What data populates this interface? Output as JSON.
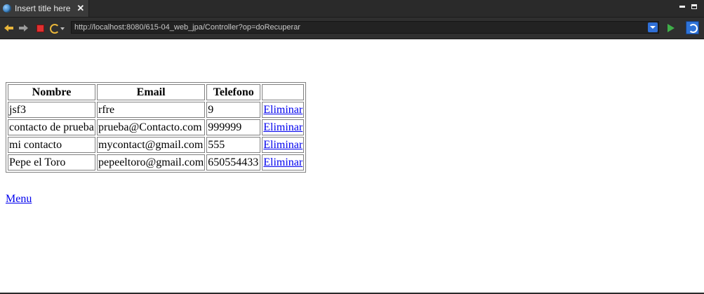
{
  "tab": {
    "title": "Insert title here",
    "close": "✕"
  },
  "toolbar": {
    "url": "http://localhost:8080/615-04_web_jpa/Controller?op=doRecuperar"
  },
  "table": {
    "headers": [
      "Nombre",
      "Email",
      "Telefono",
      ""
    ],
    "rows": [
      {
        "nombre": "jsf3",
        "email": "rfre",
        "telefono": "9",
        "accion": "Eliminar"
      },
      {
        "nombre": "contacto de prueba",
        "email": "prueba@Contacto.com",
        "telefono": "999999",
        "accion": "Eliminar"
      },
      {
        "nombre": "mi contacto",
        "email": "mycontact@gmail.com",
        "telefono": "555",
        "accion": "Eliminar"
      },
      {
        "nombre": "Pepe el Toro",
        "email": "pepeeltoro@gmail.com",
        "telefono": "650554433",
        "accion": "Eliminar"
      }
    ]
  },
  "menu_link": "Menu",
  "icons": {
    "tab": "globe-icon",
    "back": "back-arrow-icon",
    "forward": "forward-arrow-icon",
    "stop": "stop-icon",
    "refresh": "refresh-icon",
    "go": "go-icon",
    "external": "open-external-browser-icon"
  }
}
